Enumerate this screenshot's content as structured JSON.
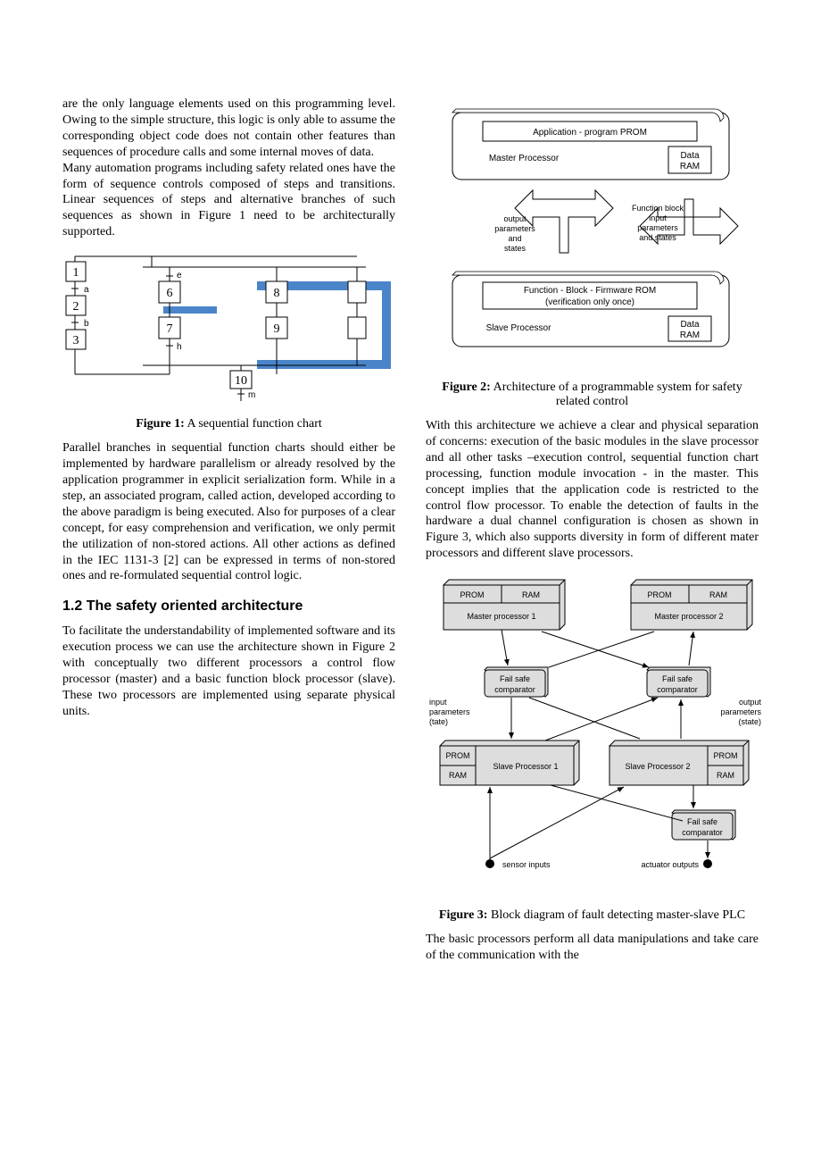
{
  "col1": {
    "para1": "are the only language elements used on this programming level. Owing to the simple structure, this logic is only able to assume the corresponding object code does not contain other features than sequences of procedure calls and some internal moves of data.",
    "para2": "Many automation programs including safety related ones have the form of sequence controls composed of steps and transitions. Linear sequences of steps and alternative branches of such sequences as shown in Figure 1 need to be architecturally supported.",
    "fig1_caption_bold": "Figure 1:",
    "fig1_caption_rest": " A sequential function chart",
    "para3": "Parallel branches in sequential function charts should either be implemented by hardware parallelism or already resolved by the application programmer in explicit serialization form. While in a step, an associated program, called action, developed according to the above paradigm is being executed. Also for purposes of a clear concept, for easy comprehension and verification, we only permit the utilization of non-stored actions. All other actions as defined in the IEC 1131-3 [2] can be expressed in terms of non-stored ones and re-formulated sequential control logic.",
    "sec_h": "1.2 The safety oriented architecture",
    "para4": "To facilitate the understandability of implemented software and its execution process we can use the architecture shown in Figure 2 with conceptually two different processors a control flow processor (master) and a basic function block processor (slave). These two processors are implemented using separate physical units."
  },
  "fig1": {
    "nodes": {
      "n1": "1",
      "n2": "2",
      "n3": "3",
      "n6": "6",
      "n7": "7",
      "n8": "8",
      "n9": "9",
      "n10": "10"
    },
    "labels": {
      "a": "a",
      "b": "b",
      "e": "e",
      "h": "h",
      "m": "m"
    }
  },
  "fig2": {
    "app_prom": "Application - program PROM",
    "master": "Master Processor",
    "data_ram1": "Data RAM",
    "out_params": [
      "output",
      "parameters",
      "and",
      "states"
    ],
    "fb_params": [
      "Function block",
      "input",
      "parameters",
      "and states"
    ],
    "fb_fw1": "Function - Block - Firmware  ROM",
    "fb_fw2": "(verification only  once)",
    "slave": "Slave Processor",
    "data_ram2": "Data RAM",
    "caption_bold": "Figure 2:",
    "caption_rest": " Architecture of a programmable system for safety related control"
  },
  "col2": {
    "para1": "With this architecture we achieve a clear and physical separation of concerns: execution of the basic modules in the slave processor and all other tasks –execution control, sequential function chart processing, function module invocation - in the master. This concept implies that the application code is restricted to the control flow processor. To enable the detection of faults in the hardware a dual channel configuration is chosen as shown in Figure 3, which also supports diversity in form of different mater processors and different slave processors."
  },
  "fig3": {
    "prom": "PROM",
    "ram": "RAM",
    "mp1": "Master processor 1",
    "mp2": "Master processor 2",
    "fsc": "Fail safe comparator",
    "inparams1": "input",
    "inparams2": "parameters",
    "inparams3": "(tate)",
    "outparams1": "output",
    "outparams2": "parameters",
    "outparams3": "(state)",
    "sp1": "Slave Processor 1",
    "sp2": "Slave Processor 2",
    "sensor": "sensor inputs",
    "actuator": "actuator outputs",
    "caption_bold": "Figure 3:",
    "caption_rest": "  Block diagram of fault detecting master-slave PLC"
  },
  "col2_end": {
    "para2": "The basic processors perform all data manipulations and take care of the communication with the"
  }
}
